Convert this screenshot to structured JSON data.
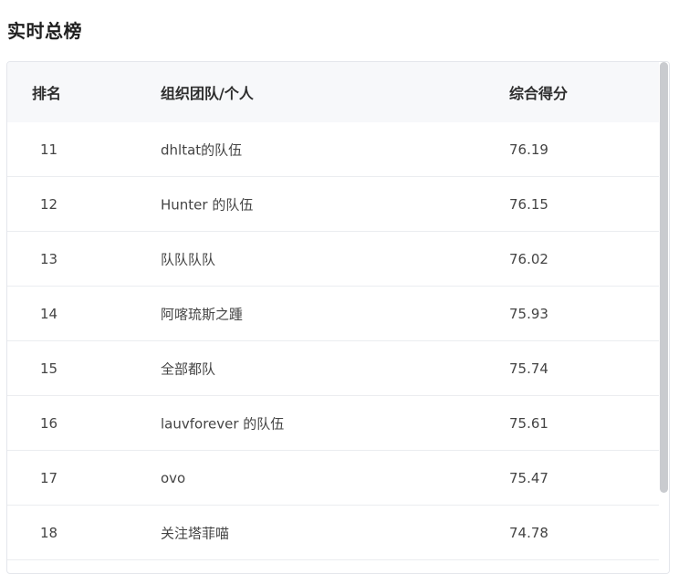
{
  "page": {
    "title": "实时总榜"
  },
  "table": {
    "headers": {
      "rank": "排名",
      "team": "组织团队/个人",
      "score": "综合得分"
    },
    "rows": [
      {
        "rank": "11",
        "team": "dhltat的队伍",
        "score": "76.19"
      },
      {
        "rank": "12",
        "team": "Hunter 的队伍",
        "score": "76.15"
      },
      {
        "rank": "13",
        "team": "队队队队",
        "score": "76.02"
      },
      {
        "rank": "14",
        "team": "阿喀琉斯之踵",
        "score": "75.93"
      },
      {
        "rank": "15",
        "team": "全部都队",
        "score": "75.74"
      },
      {
        "rank": "16",
        "team": "lauvforever 的队伍",
        "score": "75.61"
      },
      {
        "rank": "17",
        "team": "ovo",
        "score": "75.47"
      },
      {
        "rank": "18",
        "team": "关注塔菲喵",
        "score": "74.78"
      }
    ]
  }
}
